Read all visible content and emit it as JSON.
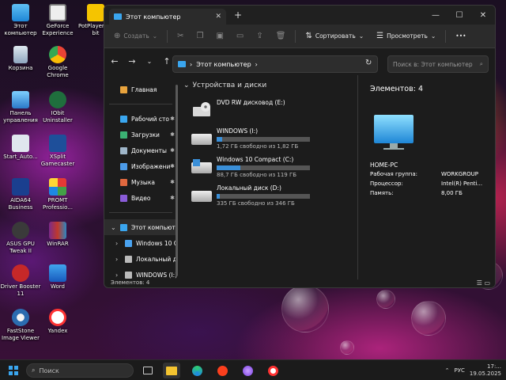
{
  "desktop": {
    "icons": [
      {
        "label": "Этот компьютер"
      },
      {
        "label": "GeForce Experience"
      },
      {
        "label": "PotPlayer 64 bit"
      },
      {
        "label": "Корзина"
      },
      {
        "label": "Google Chrome"
      },
      {
        "label": "Панель управления"
      },
      {
        "label": "IObit Uninstaller"
      },
      {
        "label": "Start_Auto..."
      },
      {
        "label": "XSplit Gamecaster"
      },
      {
        "label": "AIDA64 Business"
      },
      {
        "label": "PROMT Professio..."
      },
      {
        "label": "ASUS GPU Tweak II"
      },
      {
        "label": "WinRAR"
      },
      {
        "label": "Driver Booster 11"
      },
      {
        "label": "Word"
      },
      {
        "label": "FastStone Image Viewer"
      },
      {
        "label": "Yandex"
      }
    ]
  },
  "window": {
    "tab_title": "Этот компьютер",
    "toolbar": {
      "create": "Создать",
      "sort": "Сортировать",
      "view": "Просмотреть",
      "more": "•••"
    },
    "address": {
      "path": "Этот компьютер",
      "search_placeholder": "Поиск в: Этот компьютер"
    },
    "sidebar": {
      "home": "Главная",
      "quick": [
        {
          "label": "Рабочий сто"
        },
        {
          "label": "Загрузки"
        },
        {
          "label": "Документы"
        },
        {
          "label": "Изображени"
        },
        {
          "label": "Музыка"
        },
        {
          "label": "Видео"
        }
      ],
      "this_pc": "Этот компьютер",
      "drives": [
        {
          "label": "Windows 10 C"
        },
        {
          "label": "Локальный ди"
        },
        {
          "label": "WINDOWS (I:)"
        }
      ]
    },
    "content": {
      "group_header": "Устройства и диски",
      "drives": [
        {
          "name": "DVD RW дисковод (E:)",
          "info": "",
          "used_fraction": null
        },
        {
          "name": "WINDOWS (I:)",
          "info": "1,72 ГБ свободно из 1,82 ГБ",
          "used_fraction": 0.06
        },
        {
          "name": "Windows 10 Compact  (C:)",
          "info": "88,7 ГБ свободно из 119 ГБ",
          "used_fraction": 0.25
        },
        {
          "name": "Локальный диск (D:)",
          "info": "335 ГБ свободно из 346 ГБ",
          "used_fraction": 0.03
        }
      ]
    },
    "details": {
      "title": "Элементов: 4",
      "pc_name": "HOME-PC",
      "props": [
        {
          "key": "Рабочая группа:",
          "value": "WORKGROUP"
        },
        {
          "key": "Процессор:",
          "value": "Intel(R) Penti..."
        },
        {
          "key": "Память:",
          "value": "8,00 ГБ"
        }
      ]
    },
    "status": "Элементов: 4"
  },
  "taskbar": {
    "search_placeholder": "Поиск",
    "language": "РУС",
    "time": "17:...",
    "date": "19.05.2025"
  },
  "colors": {
    "accent": "#3a8fd8",
    "window_bg": "#1c1c1c",
    "taskbar_bg": "#1b1b1b"
  }
}
